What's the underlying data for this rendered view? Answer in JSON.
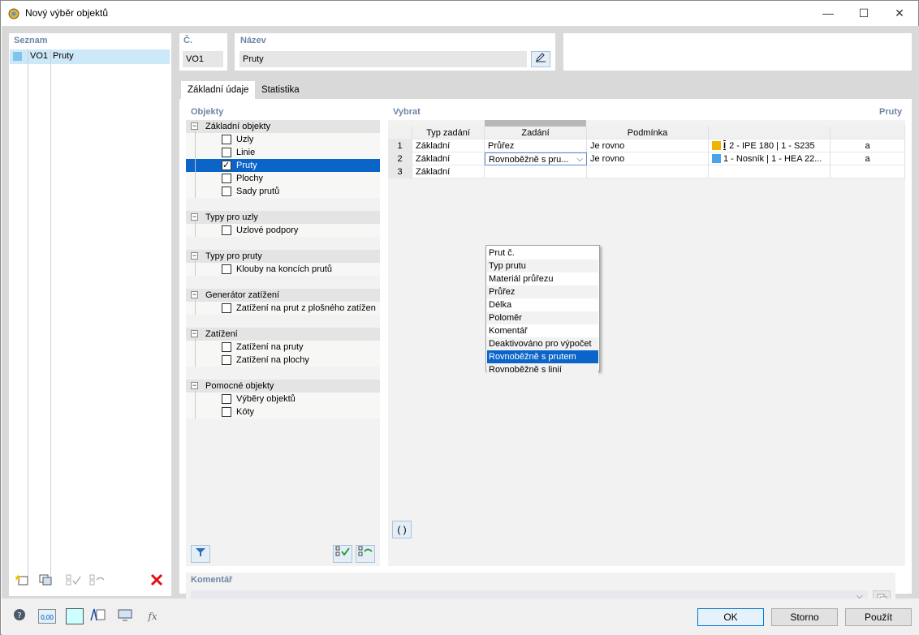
{
  "window": {
    "title": "Nový výběr objektů",
    "minimize_glyph": "—",
    "maximize_glyph": "☐",
    "close_glyph": "✕"
  },
  "list": {
    "header": "Seznam",
    "items": [
      {
        "code": "VO1",
        "name": "Pruty",
        "color": "#7ec5ee"
      }
    ]
  },
  "number": {
    "label": "Č.",
    "value": "VO1"
  },
  "name_field": {
    "label": "Název",
    "value": "Pruty"
  },
  "tabs": [
    {
      "label": "Základní údaje",
      "active": true
    },
    {
      "label": "Statistika",
      "active": false
    }
  ],
  "objects": {
    "header": "Objekty",
    "groups": [
      {
        "label": "Základní objekty",
        "items": [
          {
            "label": "Uzly",
            "checked": false
          },
          {
            "label": "Linie",
            "checked": false
          },
          {
            "label": "Pruty",
            "checked": true,
            "selected": true
          },
          {
            "label": "Plochy",
            "checked": false
          },
          {
            "label": "Sady prutů",
            "checked": false
          }
        ]
      },
      {
        "label": "Typy pro uzly",
        "items": [
          {
            "label": "Uzlové podpory",
            "checked": false
          }
        ]
      },
      {
        "label": "Typy pro pruty",
        "items": [
          {
            "label": "Klouby na koncích prutů",
            "checked": false
          }
        ]
      },
      {
        "label": "Generátor zatížení",
        "items": [
          {
            "label": "Zatížení na prut z plošného zatížen",
            "checked": false
          }
        ]
      },
      {
        "label": "Zatížení",
        "items": [
          {
            "label": "Zatížení na pruty",
            "checked": false
          },
          {
            "label": "Zatížení na plochy",
            "checked": false
          }
        ]
      },
      {
        "label": "Pomocné objekty",
        "items": [
          {
            "label": "Výběry objektů",
            "checked": false
          },
          {
            "label": "Kóty",
            "checked": false
          }
        ]
      }
    ]
  },
  "select": {
    "header": "Vybrat",
    "right_label": "Pruty",
    "columns": [
      "Typ zadání",
      "Zadání",
      "Podmínka",
      "",
      ""
    ],
    "rows": [
      {
        "num": "1",
        "type": "Základní",
        "input": "Průřez",
        "condition": "Je rovno",
        "value": "2 - IPE 180 | 1 - S235",
        "value_color": "#f0b400",
        "extra": "a"
      },
      {
        "num": "2",
        "type": "Základní",
        "input": "Rovnoběžně s pru...",
        "condition": "Je rovno",
        "value": "1 - Nosník | 1 - HEA 22...",
        "value_color": "#4da3e8",
        "extra": "a"
      },
      {
        "num": "3",
        "type": "Základní",
        "input": "",
        "condition": "",
        "value": "",
        "value_color": "",
        "extra": ""
      }
    ],
    "dropdown_options": [
      "Prut č.",
      "Typ prutu",
      "Materiál průřezu",
      "Průřez",
      "Délka",
      "Poloměr",
      "Komentář",
      "Deaktivováno pro výpočet",
      "Rovnoběžně s prutem",
      "Rovnoběžně s linií"
    ],
    "dropdown_highlighted": "Rovnoběžně s prutem",
    "paren_button": "( )"
  },
  "comment": {
    "label": "Komentář",
    "value": ""
  },
  "buttons": {
    "ok": "OK",
    "cancel": "Storno",
    "apply": "Použít"
  },
  "footer_zoom_label": "0,00"
}
